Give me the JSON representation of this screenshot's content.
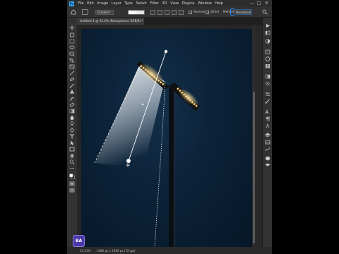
{
  "app": {
    "logo_text": "Ps",
    "menu": [
      "File",
      "Edit",
      "Image",
      "Layer",
      "Type",
      "Select",
      "Filter",
      "3D",
      "View",
      "Plugins",
      "Window",
      "Help"
    ],
    "window_controls": [
      "—",
      "□",
      "✕"
    ]
  },
  "options_bar": {
    "gradient_preset_label": "Gradient",
    "reverse_label": "Reverse",
    "dither_label": "Dither",
    "method_label": "Method:",
    "method_value": "Perceptual"
  },
  "document": {
    "tab_title": "Untitled-1 @ 32.4% (Background, RGB/8) *"
  },
  "status": {
    "zoom": "32.41%",
    "dimensions": "1080 px x 1920 px (72 ppi)"
  },
  "badge": {
    "text": "BA"
  },
  "colors": {
    "accent": "#31a8ff",
    "sky_dark": "#061728",
    "lamp_glow": "#ffd27a",
    "badge_bg": "#4b38a8"
  },
  "icons": {
    "toolbar": [
      "move-icon",
      "artboard-icon",
      "marquee-icon",
      "lasso-icon",
      "object-select-icon",
      "crop-icon",
      "frame-icon",
      "eyedropper-icon",
      "spot-heal-icon",
      "brush-icon",
      "clone-stamp-icon",
      "history-brush-icon",
      "eraser-icon",
      "gradient-icon",
      "blur-icon",
      "dodge-icon",
      "pen-icon",
      "type-icon",
      "path-select-icon",
      "rectangle-icon",
      "hand-icon",
      "zoom-icon",
      "more-tools-icon",
      "color-swatches-icon",
      "quick-mask-icon",
      "screen-mode-icon"
    ],
    "panels": [
      "learn-icon",
      "libraries-icon",
      "adjustments-icon",
      "history-icon",
      "color-icon",
      "swatches-icon",
      "gradients-icon",
      "patterns-icon",
      "properties-icon",
      "brush-settings-icon",
      "character-icon",
      "paragraph-icon",
      "glyphs-icon",
      "layers-icon",
      "channels-icon",
      "paths-icon"
    ]
  }
}
